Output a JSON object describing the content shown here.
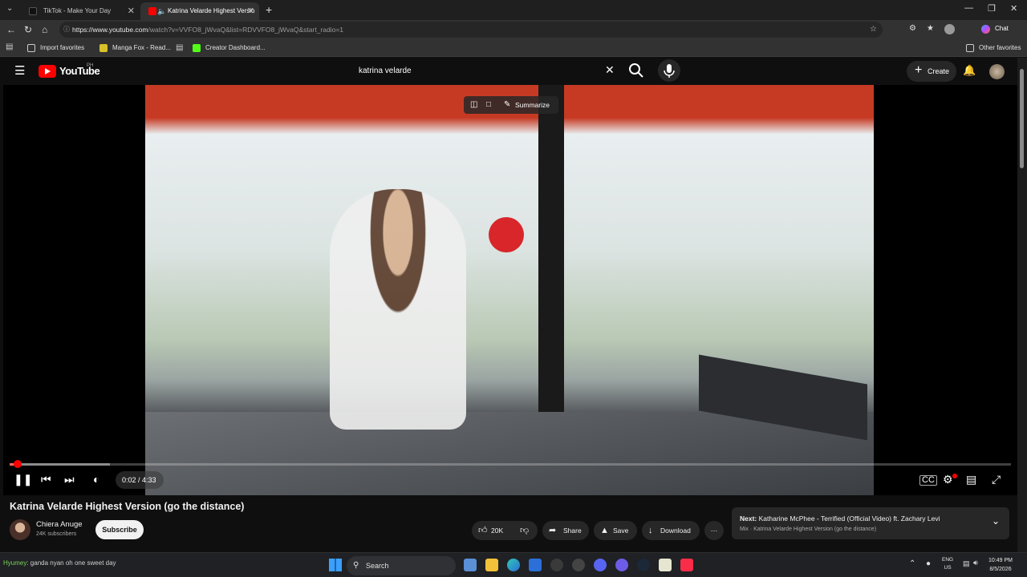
{
  "browser": {
    "tabs": [
      {
        "label": "TikTok - Make Your Day",
        "active": false
      },
      {
        "label": "Katrina Velarde Highest Versio",
        "active": true
      }
    ],
    "url_host": "https://www.youtube.com",
    "url_path": "/watch?v=VVFO8_jWvaQ&list=RDVVFO8_jWvaQ&start_radio=1",
    "bookmarks": [
      "Import favorites",
      "Manga Fox - Read...",
      "Creator Dashboard..."
    ],
    "other_favorites": "Other favorites",
    "chat_label": "Chat"
  },
  "youtube": {
    "logo_text": "YouTube",
    "country": "PH",
    "search_query": "katrina velarde",
    "create_label": "Create"
  },
  "player": {
    "summarize_label": "Summarize",
    "time": "0:02 / 4:33",
    "progress_fraction": 0.007
  },
  "video": {
    "title": "Katrina Velarde Highest Version (go the distance)",
    "channel": "Chiera Anuge",
    "subscribers": "24K subscribers",
    "subscribe_label": "Subscribe",
    "likes": "20K",
    "share_label": "Share",
    "save_label": "Save",
    "download_label": "Download"
  },
  "next": {
    "prefix": "Next:",
    "title": "Katharine McPhee - Terrified (Official Video) ft. Zachary Levi",
    "mix": "Mix · Katrina Velarde Highest Version (go the distance)"
  },
  "taskbar": {
    "ticker_user": "Hyumey",
    "ticker_text": ": ganda nyan oh one sweet day",
    "search_label": "Search",
    "lang_1": "ENG",
    "lang_2": "US",
    "time": "10:49 PM",
    "date": "8/5/2026"
  },
  "colors": {
    "accent": "#ff0000",
    "background": "#0f0f0f",
    "chip": "#272727"
  }
}
